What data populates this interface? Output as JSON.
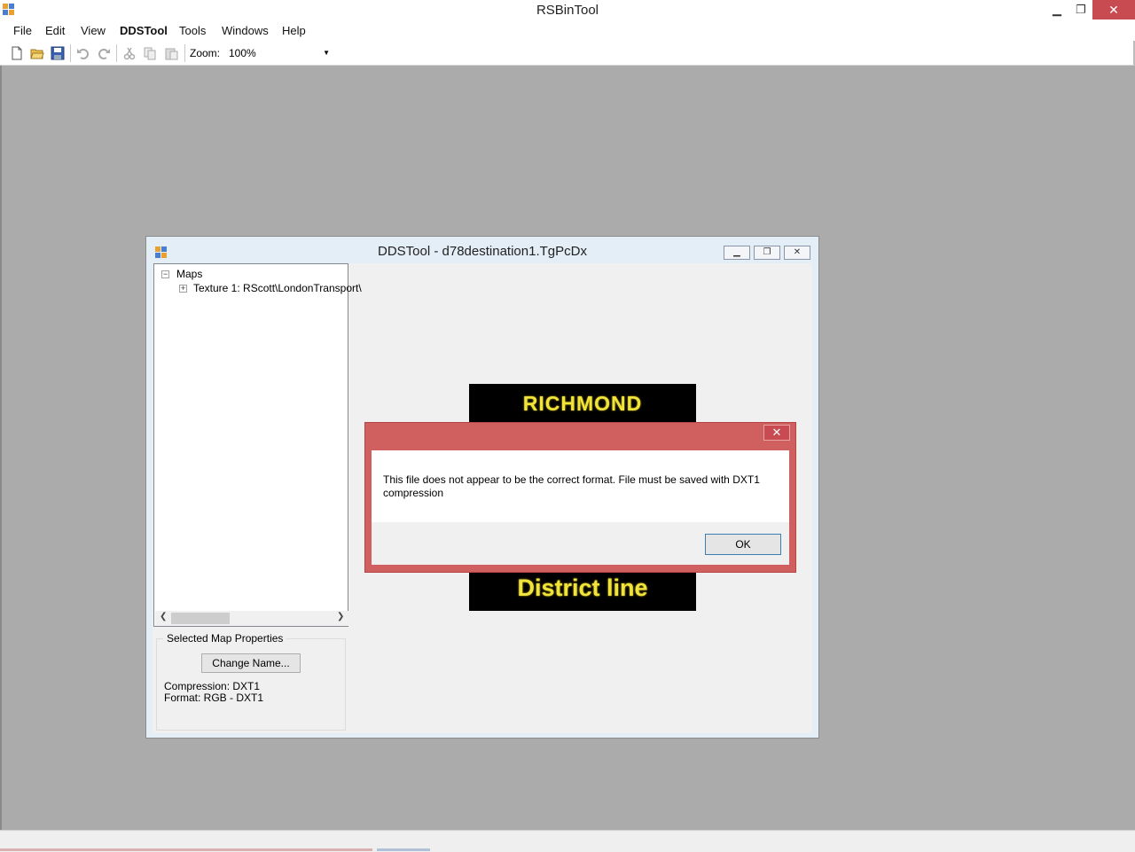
{
  "app": {
    "title": "RSBinTool"
  },
  "window_controls": {
    "minimize": "▁",
    "maximize": "❐",
    "close": "✕"
  },
  "menu": [
    "File",
    "Edit",
    "View",
    "DDSTool",
    "Tools",
    "Windows",
    "Help"
  ],
  "toolbar": {
    "icons": [
      "new-file-icon",
      "open-folder-icon",
      "save-icon",
      "undo-icon",
      "redo-icon",
      "cut-icon",
      "copy-icon",
      "paste-icon"
    ],
    "zoom_label": "Zoom:",
    "zoom_value": "100%"
  },
  "child_window": {
    "title": "DDSTool - d78destination1.TgPcDx",
    "tree": {
      "root": "Maps",
      "child": "Texture 1: RScott\\LondonTransport\\"
    },
    "properties": {
      "legend": "Selected Map Properties",
      "change_name": "Change Name...",
      "compression": "Compression: DXT1",
      "format": "Format: RGB - DXT1"
    },
    "texture": {
      "top_text": "RICHMOND",
      "bottom_text": "District line",
      "text_color": "#f0e33c"
    }
  },
  "dialog": {
    "close": "✕",
    "message": "This file does not appear to be the correct format. File must be saved with DXT1 compression",
    "ok": "OK"
  },
  "colors": {
    "workspace": "#ababab",
    "dialog_frame": "#d0605f",
    "close_red": "#c74b50"
  }
}
